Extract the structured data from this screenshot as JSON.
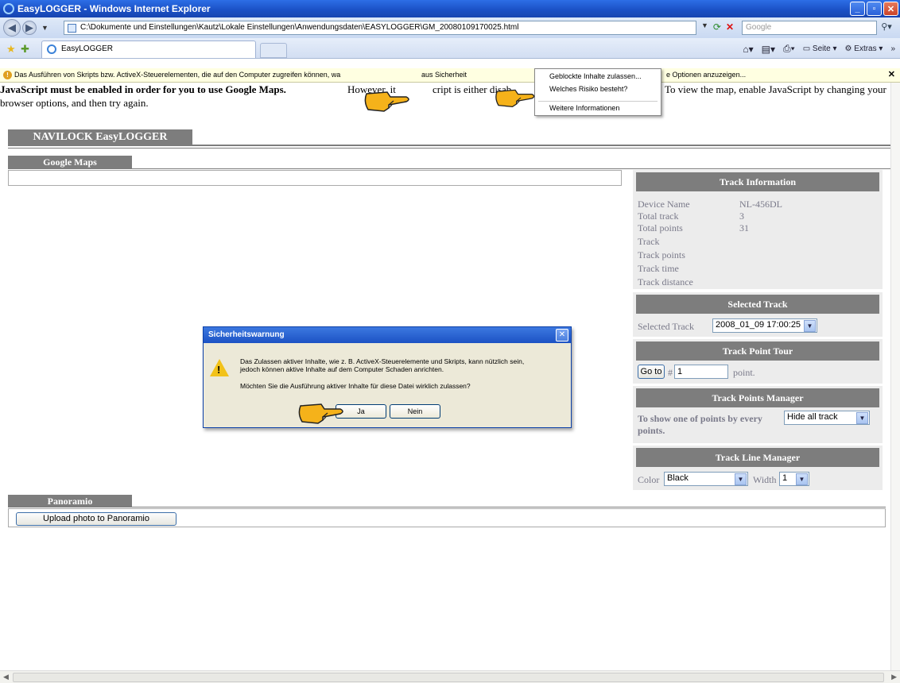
{
  "window": {
    "title": "EasyLOGGER - Windows Internet Explorer"
  },
  "address_bar": {
    "url": "C:\\Dokumente und Einstellungen\\Kautz\\Lokale Einstellungen\\Anwendungsdaten\\EASYLOGGER\\GM_20080109170025.html",
    "search_placeholder": "Google"
  },
  "tabs": [
    {
      "label": "EasyLOGGER"
    }
  ],
  "command_bar": {
    "page_label": "Seite",
    "extras_label": "Extras"
  },
  "info_bar": {
    "text_start": "Das Ausführen von Skripts bzw. ActiveX-Steuerelementen, die auf den Computer zugreifen können, wa",
    "text_mid": "aus Sicherheit",
    "text_end": "e Optionen anzuzeigen..."
  },
  "context_menu": {
    "items": [
      "Geblockte Inhalte zulassen...",
      "Welches Risiko besteht?",
      "Weitere Informationen"
    ]
  },
  "page": {
    "js_message_bold": "JavaScript must be enabled in order for you to use Google Maps.",
    "js_message_mid": " However, it",
    "js_message_mid2": "cript is either disab",
    "js_message_rest": "To view the map, enable JavaScript by changing your",
    "js_message_line2": "browser options, and then try again.",
    "navilock_tab": "NAVILOCK EasyLOGGER",
    "google_maps_tab": "Google Maps",
    "panoramio_tab": "Panoramio",
    "upload_button": "Upload photo to Panoramio"
  },
  "track_information": {
    "header": "Track Information",
    "rows": [
      {
        "key": "Device Name",
        "value": "NL-456DL"
      },
      {
        "key": "Total track",
        "value": "3"
      },
      {
        "key": "Total points",
        "value": "31"
      },
      {
        "key": "Track",
        "value": ""
      },
      {
        "key": "Track points",
        "value": ""
      },
      {
        "key": "Track time",
        "value": ""
      },
      {
        "key": "Track distance",
        "value": ""
      }
    ]
  },
  "selected_track": {
    "header": "Selected Track",
    "label": "Selected Track",
    "value": "2008_01_09 17:00:25"
  },
  "track_point_tour": {
    "header": "Track Point Tour",
    "go_button": "Go to",
    "hash": "#",
    "input_value": "1",
    "suffix": "point."
  },
  "track_points_manager": {
    "header": "Track Points Manager",
    "label_line1": "To show one of points by every",
    "label_line2": "points.",
    "select_value": "Hide all track"
  },
  "track_line_manager": {
    "header": "Track Line Manager",
    "color_label": "Color",
    "color_value": "Black",
    "width_label": "Width",
    "width_value": "1"
  },
  "dialog": {
    "title": "Sicherheitswarnung",
    "line1": "Das Zulassen aktiver Inhalte, wie z. B. ActiveX-Steuerelemente und Skripts, kann nützlich sein,",
    "line2": "jedoch können aktive Inhalte auf dem Computer Schaden anrichten.",
    "line3": "Möchten Sie die Ausführung aktiver Inhalte für diese Datei wirklich zulassen?",
    "yes_button": "Ja",
    "no_button": "Nein"
  },
  "colors": {
    "section_gray": "#7d7d7d",
    "panel_bg": "#ececec",
    "infobar_bg": "#ffffe1",
    "titlebar_blue": "#1a4fc4"
  }
}
